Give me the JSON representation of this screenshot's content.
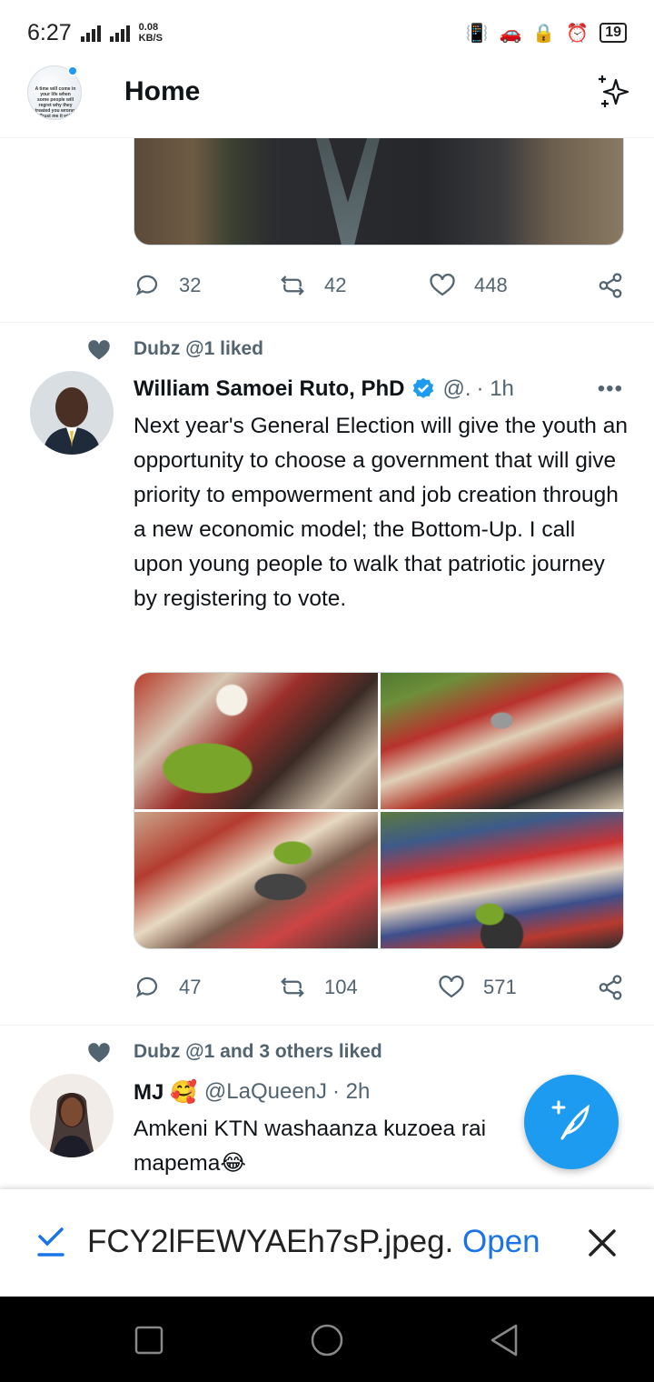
{
  "status_bar": {
    "time": "6:27",
    "net_speed_value": "0.08",
    "net_speed_unit": "KB/S",
    "battery": "19"
  },
  "header": {
    "title": "Home",
    "avatar_text": "A time will come in your life when some people will regret why they treated you wrong. Trust me it will definitely come"
  },
  "prev_tweet": {
    "replies": "32",
    "retweets": "42",
    "likes": "448"
  },
  "tweet1": {
    "social_context": "Dubz @1 liked",
    "name": "William Samoei Ruto, PhD",
    "handle": "@.",
    "time": "· 1h",
    "text": "Next year's General Election will give the youth an opportunity to choose a government that will give priority to empowerment and job creation through a new economic model; the Bottom-Up. I call upon young people to walk that patriotic journey by registering to vote.",
    "replies": "47",
    "retweets": "104",
    "likes": "571"
  },
  "tweet2": {
    "social_context": "Dubz @1 and 3 others liked",
    "name": "MJ 🥰",
    "handle": "@LaQueenJ",
    "time": "· 2h",
    "text_line1": "Amkeni KTN washaanza kuzoea rai",
    "text_line2": "mapema😂"
  },
  "download": {
    "filename": "FCY2lFEWYAEh7sP.jpeg.",
    "open_label": "Open"
  },
  "colors": {
    "accent": "#1d9bf0",
    "secondary_text": "#536471",
    "link": "#1a73e8"
  }
}
